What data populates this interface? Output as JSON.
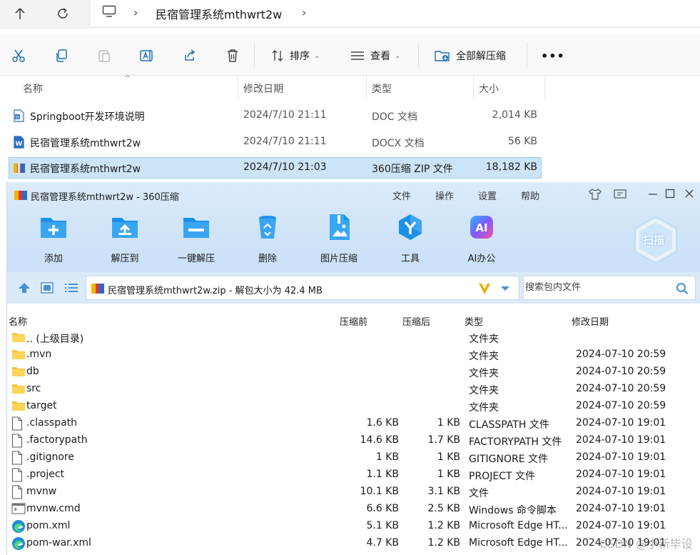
{
  "explorer": {
    "breadcrumb": "民宿管理系统mthwrt2w",
    "commands": {
      "sort": "排序",
      "view": "查看",
      "extract_all": "全部解压缩",
      "more": "•••"
    },
    "columns": [
      "名称",
      "修改日期",
      "类型",
      "大小"
    ],
    "files": [
      {
        "name": "Springboot开发环境说明",
        "date": "2024/7/10 21:11",
        "type": "DOC 文档",
        "size": "2,014 KB",
        "icon": "word-doc-icon"
      },
      {
        "name": "民宿管理系统mthwrt2w",
        "date": "2024/7/10 21:11",
        "type": "DOCX 文档",
        "size": "56 KB",
        "icon": "word-docx-icon"
      },
      {
        "name": "民宿管理系统mthwrt2w",
        "date": "2024/7/10 21:03",
        "type": "360压缩 ZIP 文件",
        "size": "18,182 KB",
        "icon": "zip-archive-icon",
        "selected": true
      }
    ]
  },
  "zip_app": {
    "title": "民宿管理系统mthwrt2w - 360压缩",
    "menu": [
      "文件",
      "操作",
      "设置",
      "帮助"
    ],
    "toolbar": [
      "添加",
      "解压到",
      "一键解压",
      "删除",
      "图片压缩",
      "工具",
      "AI办公"
    ],
    "scan_label": "扫描",
    "path_text": "民宿管理系统mthwrt2w.zip - 解包大小为 42.4 MB",
    "search_placeholder": "搜索包内文件",
    "columns": [
      "名称",
      "压缩前",
      "压缩后",
      "类型",
      "修改日期"
    ],
    "rows": [
      {
        "name": ".. (上级目录)",
        "before": "",
        "after": "",
        "type": "文件夹",
        "date": "",
        "icon": "folder"
      },
      {
        "name": ".mvn",
        "before": "",
        "after": "",
        "type": "文件夹",
        "date": "2024-07-10 20:59",
        "icon": "folder"
      },
      {
        "name": "db",
        "before": "",
        "after": "",
        "type": "文件夹",
        "date": "2024-07-10 20:59",
        "icon": "folder"
      },
      {
        "name": "src",
        "before": "",
        "after": "",
        "type": "文件夹",
        "date": "2024-07-10 20:59",
        "icon": "folder"
      },
      {
        "name": "target",
        "before": "",
        "after": "",
        "type": "文件夹",
        "date": "2024-07-10 20:59",
        "icon": "folder"
      },
      {
        "name": ".classpath",
        "before": "1.6 KB",
        "after": "1 KB",
        "type": "CLASSPATH 文件",
        "date": "2024-07-10 19:01",
        "icon": "file"
      },
      {
        "name": ".factorypath",
        "before": "14.6 KB",
        "after": "1.7 KB",
        "type": "FACTORYPATH 文件",
        "date": "2024-07-10 19:01",
        "icon": "file"
      },
      {
        "name": ".gitignore",
        "before": "1 KB",
        "after": "1 KB",
        "type": "GITIGNORE 文件",
        "date": "2024-07-10 19:01",
        "icon": "file"
      },
      {
        "name": ".project",
        "before": "1.1 KB",
        "after": "1 KB",
        "type": "PROJECT 文件",
        "date": "2024-07-10 19:01",
        "icon": "file"
      },
      {
        "name": "mvnw",
        "before": "10.1 KB",
        "after": "3.1 KB",
        "type": "文件",
        "date": "2024-07-10 19:01",
        "icon": "file"
      },
      {
        "name": "mvnw.cmd",
        "before": "6.6 KB",
        "after": "2.5 KB",
        "type": "Windows 命令脚本",
        "date": "2024-07-10 19:01",
        "icon": "cmd"
      },
      {
        "name": "pom.xml",
        "before": "5.1 KB",
        "after": "1.2 KB",
        "type": "Microsoft Edge HT...",
        "date": "2024-07-10 19:01",
        "icon": "edge"
      },
      {
        "name": "pom-war.xml",
        "before": "4.7 KB",
        "after": "1.2 KB",
        "type": "Microsoft Edge HT...",
        "date": "2024-07-10 19:01",
        "icon": "edge"
      }
    ]
  },
  "watermark": "CSDN @小新毕设"
}
